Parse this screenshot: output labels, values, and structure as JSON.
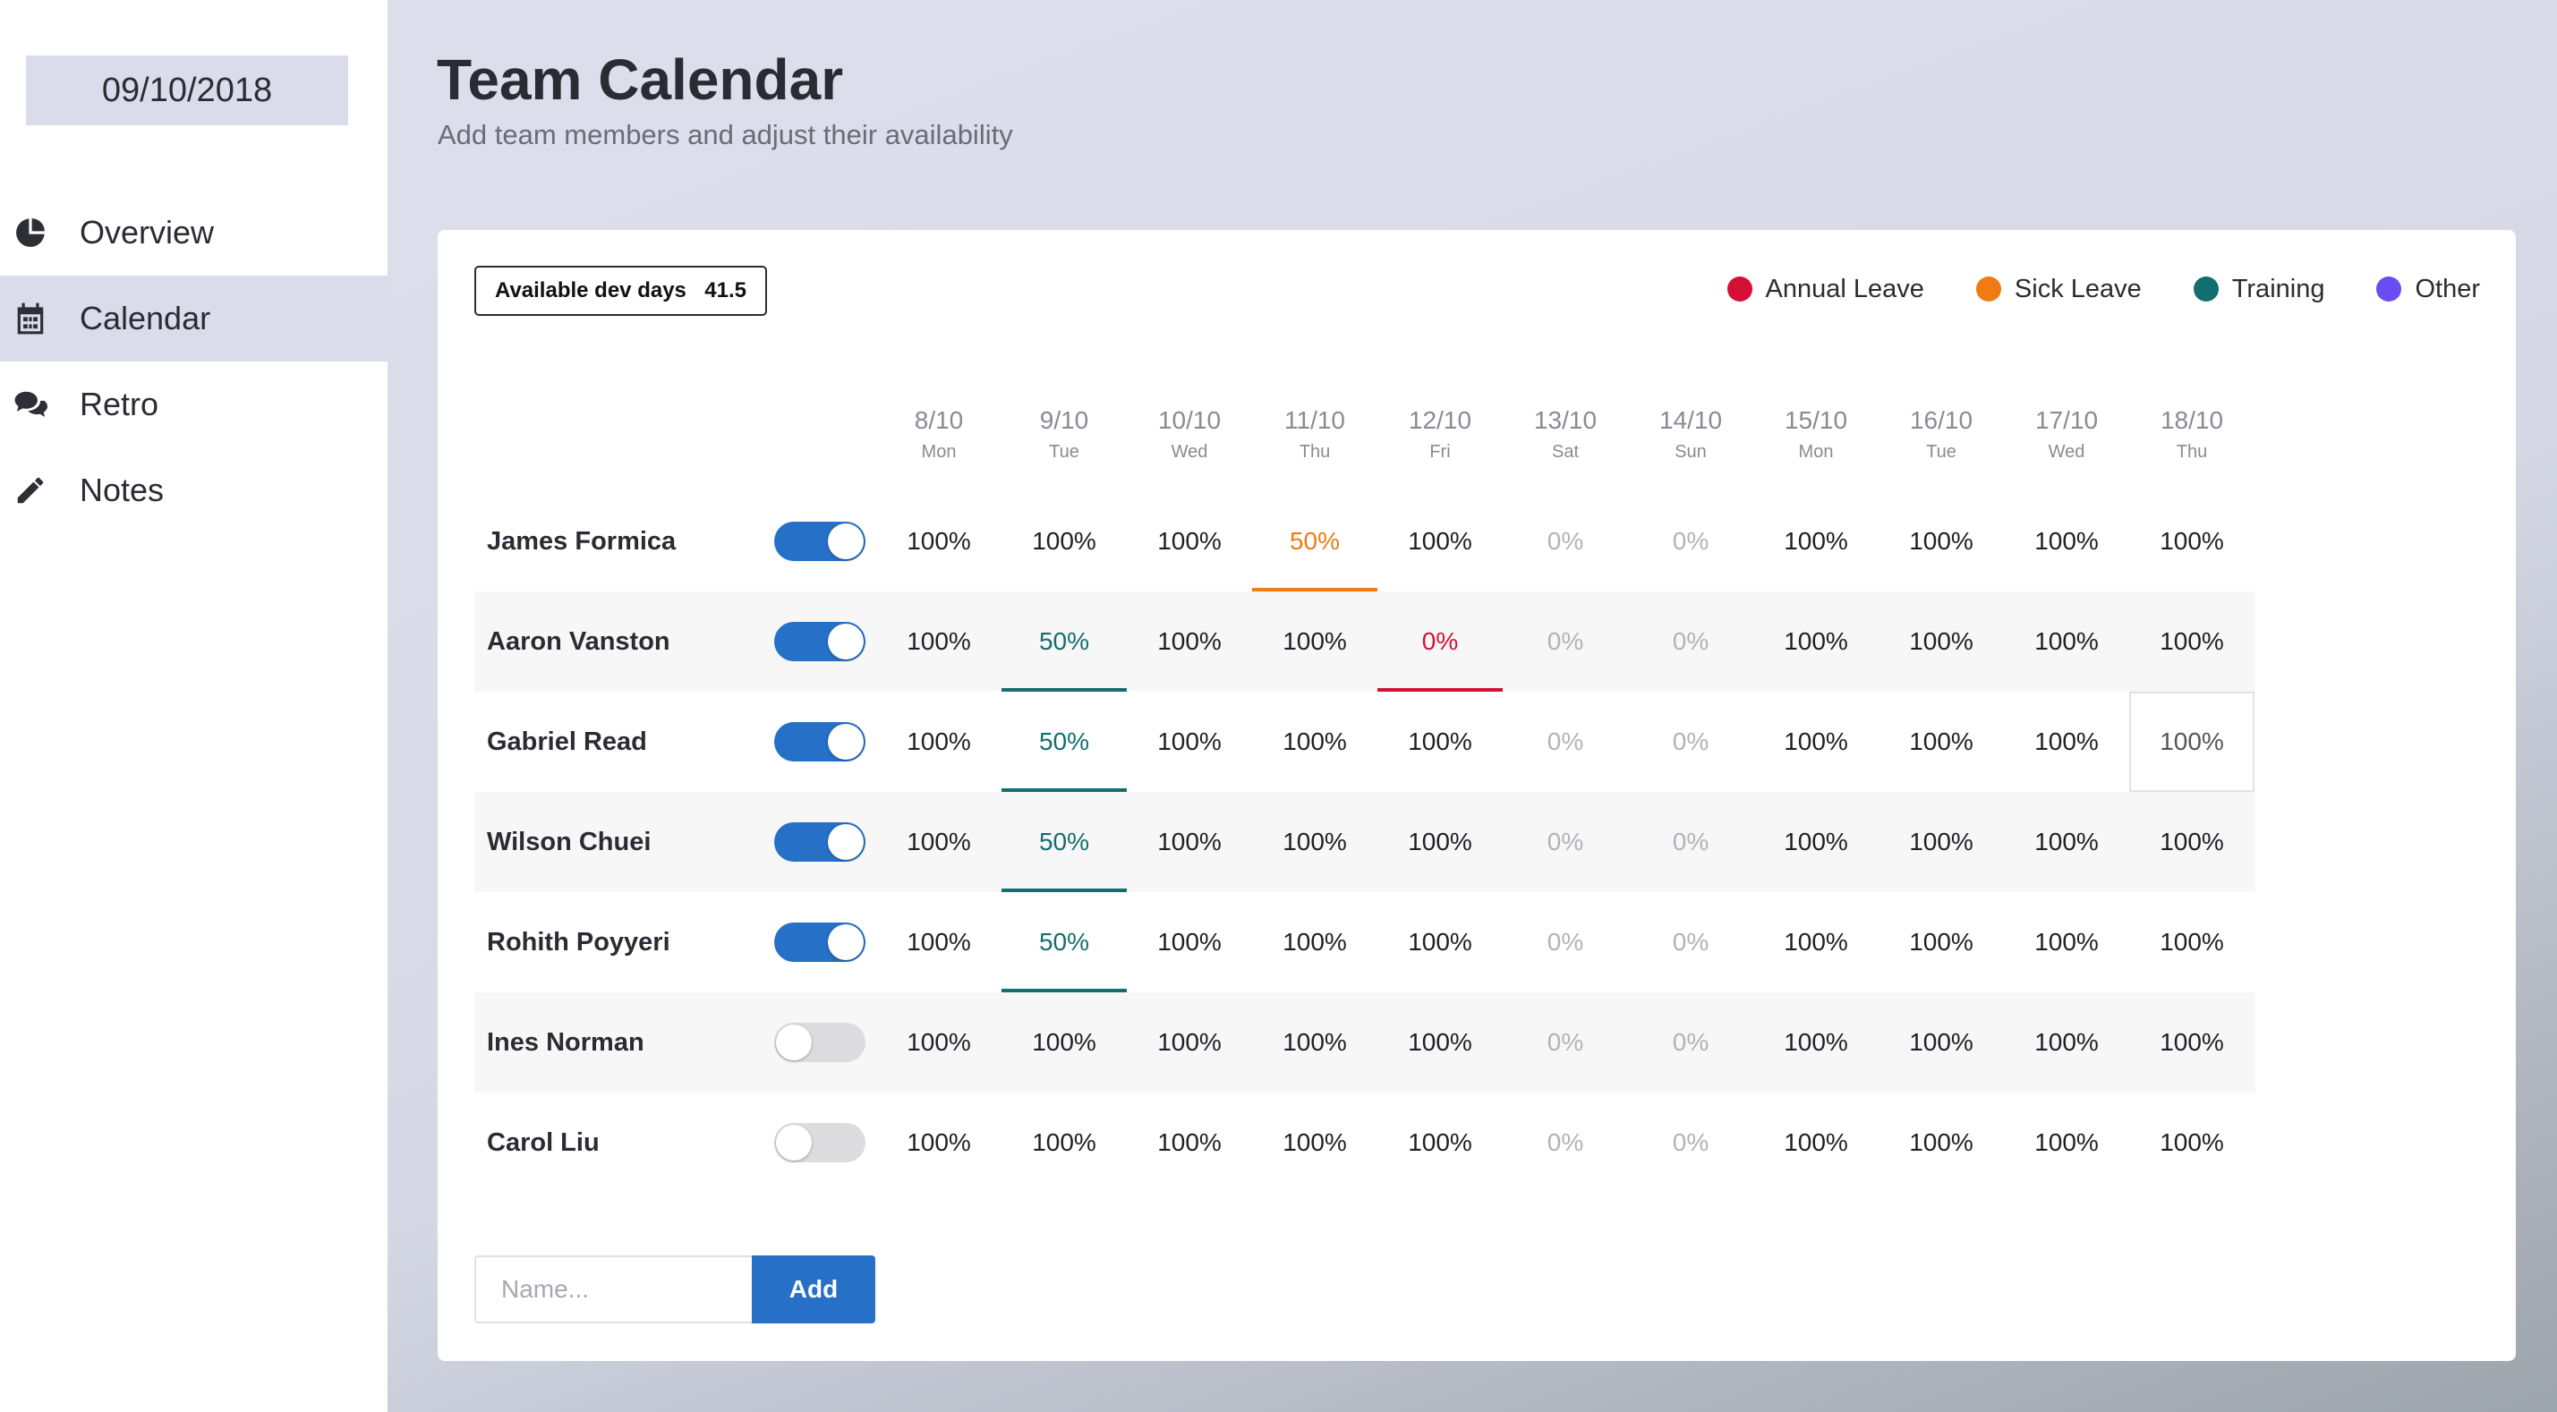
{
  "sidebar": {
    "date": "09/10/2018",
    "items": [
      {
        "label": "Overview",
        "icon": "pie-chart-icon",
        "active": false
      },
      {
        "label": "Calendar",
        "icon": "calendar-icon",
        "active": true
      },
      {
        "label": "Retro",
        "icon": "comments-icon",
        "active": false
      },
      {
        "label": "Notes",
        "icon": "pencil-icon",
        "active": false
      }
    ]
  },
  "header": {
    "title": "Team Calendar",
    "subtitle": "Add team members and adjust their availability"
  },
  "summary": {
    "label": "Available dev days",
    "value": "41.5"
  },
  "legend": [
    {
      "label": "Annual Leave",
      "color": "#d51037"
    },
    {
      "label": "Sick Leave",
      "color": "#f07a13"
    },
    {
      "label": "Training",
      "color": "#136e6e"
    },
    {
      "label": "Other",
      "color": "#6a4df0"
    }
  ],
  "days": [
    {
      "date": "8/10",
      "day": "Mon"
    },
    {
      "date": "9/10",
      "day": "Tue"
    },
    {
      "date": "10/10",
      "day": "Wed"
    },
    {
      "date": "11/10",
      "day": "Thu"
    },
    {
      "date": "12/10",
      "day": "Fri"
    },
    {
      "date": "13/10",
      "day": "Sat"
    },
    {
      "date": "14/10",
      "day": "Sun"
    },
    {
      "date": "15/10",
      "day": "Mon"
    },
    {
      "date": "16/10",
      "day": "Tue"
    },
    {
      "date": "17/10",
      "day": "Wed"
    },
    {
      "date": "18/10",
      "day": "Thu"
    }
  ],
  "members": [
    {
      "name": "James Formica",
      "active": true,
      "values": [
        "100%",
        "100%",
        "100%",
        "50%",
        "100%",
        "0%",
        "0%",
        "100%",
        "100%",
        "100%",
        "100%"
      ],
      "leave": [
        null,
        null,
        null,
        "sick",
        null,
        null,
        null,
        null,
        null,
        null,
        null
      ]
    },
    {
      "name": "Aaron Vanston",
      "active": true,
      "values": [
        "100%",
        "50%",
        "100%",
        "100%",
        "0%",
        "0%",
        "0%",
        "100%",
        "100%",
        "100%",
        "100%"
      ],
      "leave": [
        null,
        "training",
        null,
        null,
        "annual",
        null,
        null,
        null,
        null,
        null,
        null
      ]
    },
    {
      "name": "Gabriel Read",
      "active": true,
      "values": [
        "100%",
        "50%",
        "100%",
        "100%",
        "100%",
        "0%",
        "0%",
        "100%",
        "100%",
        "100%",
        "100%"
      ],
      "leave": [
        null,
        "training",
        null,
        null,
        null,
        null,
        null,
        null,
        null,
        null,
        null
      ]
    },
    {
      "name": "Wilson Chuei",
      "active": true,
      "values": [
        "100%",
        "50%",
        "100%",
        "100%",
        "100%",
        "0%",
        "0%",
        "100%",
        "100%",
        "100%",
        "100%"
      ],
      "leave": [
        null,
        "training",
        null,
        null,
        null,
        null,
        null,
        null,
        null,
        null,
        null
      ]
    },
    {
      "name": "Rohith Poyyeri",
      "active": true,
      "values": [
        "100%",
        "50%",
        "100%",
        "100%",
        "100%",
        "0%",
        "0%",
        "100%",
        "100%",
        "100%",
        "100%"
      ],
      "leave": [
        null,
        "training",
        null,
        null,
        null,
        null,
        null,
        null,
        null,
        null,
        null
      ]
    },
    {
      "name": "Ines Norman",
      "active": false,
      "values": [
        "100%",
        "100%",
        "100%",
        "100%",
        "100%",
        "0%",
        "0%",
        "100%",
        "100%",
        "100%",
        "100%"
      ],
      "leave": [
        null,
        null,
        null,
        null,
        null,
        null,
        null,
        null,
        null,
        null,
        null
      ]
    },
    {
      "name": "Carol Liu",
      "active": false,
      "values": [
        "100%",
        "100%",
        "100%",
        "100%",
        "100%",
        "0%",
        "0%",
        "100%",
        "100%",
        "100%",
        "100%"
      ],
      "leave": [
        null,
        null,
        null,
        null,
        null,
        null,
        null,
        null,
        null,
        null,
        null
      ]
    }
  ],
  "add_form": {
    "placeholder": "Name...",
    "button_label": "Add"
  }
}
